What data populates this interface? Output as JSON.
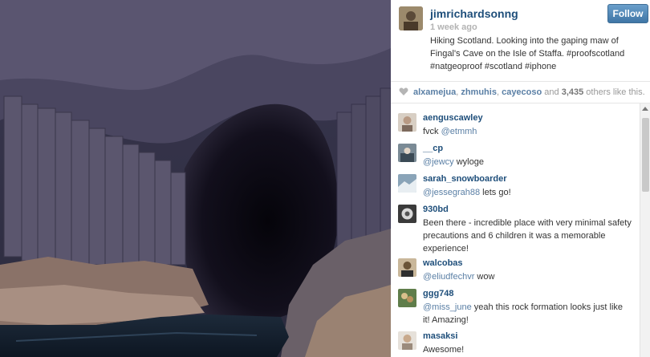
{
  "post": {
    "username": "jimrichardsonng",
    "follow_label": "Follow",
    "time": "1 week ago",
    "caption": "Hiking Scotland. Looking into the gaping maw of Fingal's Cave on the Isle of Staffa. #proofscotland #natgeoproof #scotland #iphone"
  },
  "likes": {
    "user1": "alxamejua",
    "sep1": ", ",
    "user2": "zhmuhis",
    "sep2": ", ",
    "user3": "cayecoso",
    "and": " and ",
    "count": "3,435",
    "suffix": " others like this."
  },
  "comments": [
    {
      "user": "aenguscawley",
      "text": "fvck ",
      "mention": "@etmmh",
      "rest": ""
    },
    {
      "user": "__cp",
      "text": "",
      "mention": "@jewcy",
      "rest": "  wyloge"
    },
    {
      "user": "sarah_snowboarder",
      "text": "",
      "mention": "@jessegrah88",
      "rest": " lets go!"
    },
    {
      "user": "930bd",
      "text": "Been there - incredible place with very minimal safety precautions and 6 children it was a memorable experience!",
      "mention": "",
      "rest": ""
    },
    {
      "user": "walcobas",
      "text": "",
      "mention": "@eliudfechvr",
      "rest": " wow"
    },
    {
      "user": "ggg748",
      "text": "",
      "mention": "@miss_june",
      "rest": " yeah this rock formation looks just like it! Amazing!"
    },
    {
      "user": "masaksi",
      "text": "Awesome!",
      "mention": "",
      "rest": ""
    }
  ],
  "icons": {
    "heart": "heart-icon",
    "scroll": "scroll-up-arrow"
  },
  "colors": {
    "username": "#1e4e7a",
    "mention": "#5a7fa5",
    "follow_button": "#4f86b6"
  }
}
